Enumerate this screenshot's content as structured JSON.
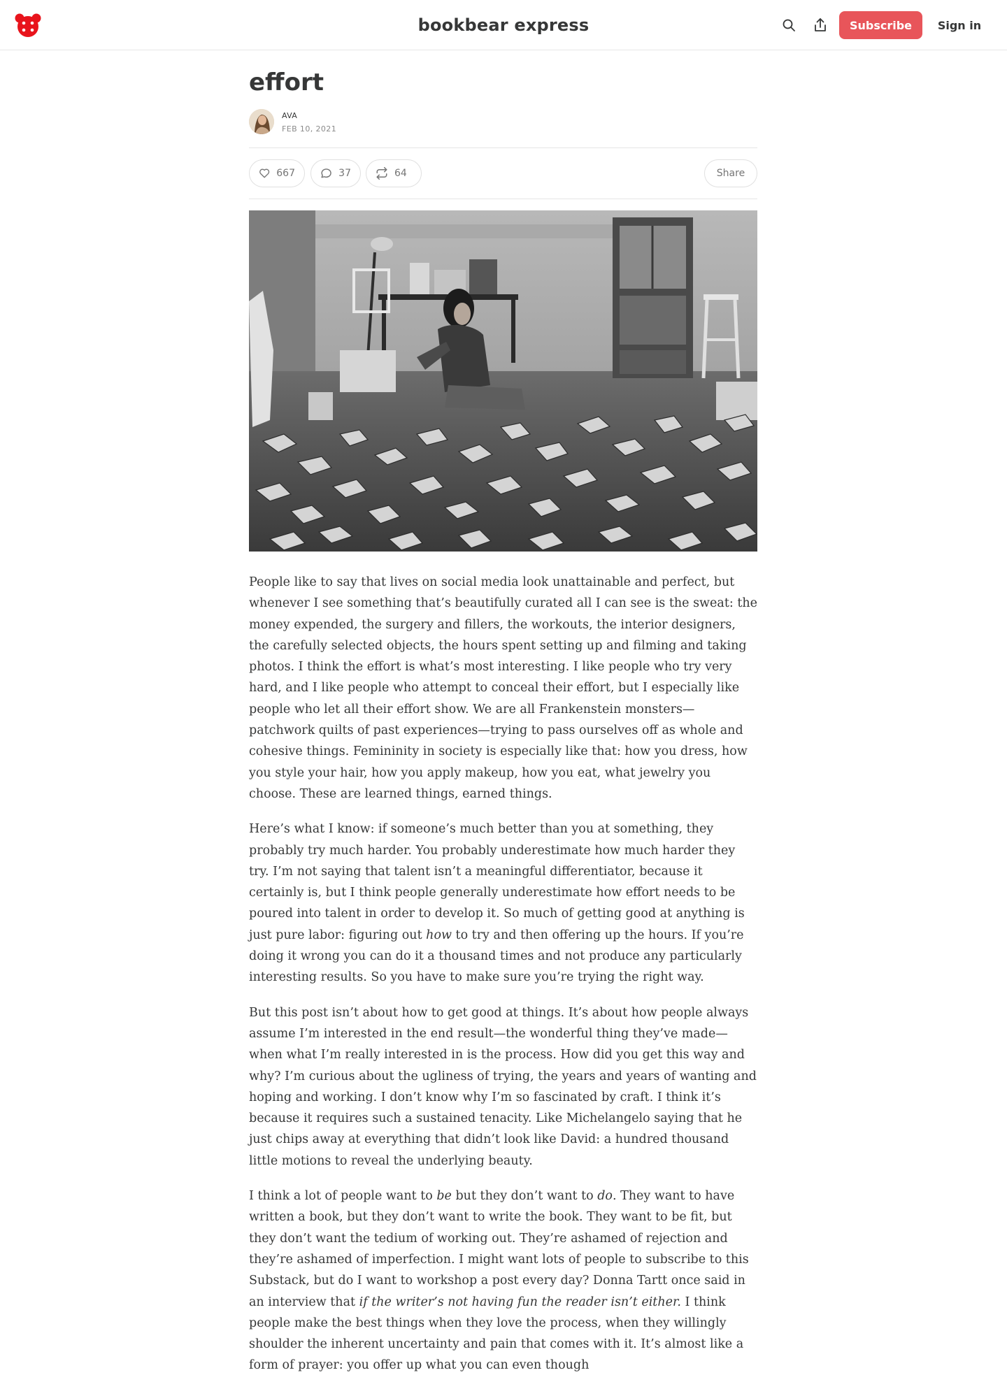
{
  "header": {
    "site_title": "bookbear express",
    "subscribe_label": "Subscribe",
    "signin_label": "Sign in",
    "logo_icon": "bear-logo-icon",
    "accent_color": "#e8555a"
  },
  "post": {
    "title": "effort",
    "author": "AVA",
    "date": "FEB 10, 2021",
    "likes": "667",
    "comments": "37",
    "restacks": "64",
    "share_label": "Share",
    "paragraphs": [
      [
        {
          "text": "People like to say that lives on social media look unattainable and perfect, but whenever I see something that’s beautifully curated all I can see is the sweat: the money expended, the surgery and fillers, the workouts, the interior designers, the carefully selected objects, the hours spent setting up and filming and taking photos. I think the effort is what’s most interesting. I like people who try very hard, and I like people who attempt to conceal their effort, but I especially like people who let all their effort show. We are all Frankenstein monsters—patchwork quilts of past experiences—trying to pass ourselves off as whole and cohesive things. Femininity in society is especially like that: how you dress, how you style your hair, how you apply makeup, how you eat, what jewelry you choose. These are learned things, earned things."
        }
      ],
      [
        {
          "text": "Here’s what I know: if someone’s much better than you at something, they probably try much harder. You probably underestimate how much harder they try. I’m not saying that talent isn’t a meaningful differentiator, because it certainly is, but I think people generally underestimate how effort needs to be poured into talent in order to develop it. So much of getting good at anything is just pure labor: figuring out "
        },
        {
          "text": "how",
          "italic": true
        },
        {
          "text": " to try and then offering up the hours. If you’re doing it wrong you can do it a thousand times and not produce any particularly interesting results. So you have to make sure you’re trying the right way."
        }
      ],
      [
        {
          "text": "But this post isn’t about how to get good at things. It’s about how people always assume I’m interested in the end result—the wonderful thing they’ve made—when what I’m really interested in is the process. How did you get this way and why? I’m curious about the ugliness of trying, the years and years of wanting and hoping and working. I don’t know why I’m so fascinated by craft. I think it’s because it requires such a sustained tenacity. Like Michelangelo saying that he just chips away at everything that didn’t look like David: a hundred thousand little motions to reveal the underlying beauty."
        }
      ],
      [
        {
          "text": "I think a lot of people want to "
        },
        {
          "text": "be",
          "italic": true
        },
        {
          "text": " but they don’t want to "
        },
        {
          "text": "do",
          "italic": true
        },
        {
          "text": ". They want to have written a book, but they don’t want to write the book. They want to be fit, but they don’t want the tedium of working out. They’re ashamed of rejection and they’re ashamed of imperfection. I might want lots of people to subscribe to this Substack, but do I want to workshop a post every day? Donna Tartt once said in an interview that "
        },
        {
          "text": "if the writer’s not having fun the reader isn’t either.",
          "italic": true
        },
        {
          "text": " I think people make the best things when they love the process, when they willingly shoulder the inherent uncertainty and pain that comes with it. It’s almost like a form of prayer: you offer up what you can even though"
        }
      ]
    ]
  }
}
